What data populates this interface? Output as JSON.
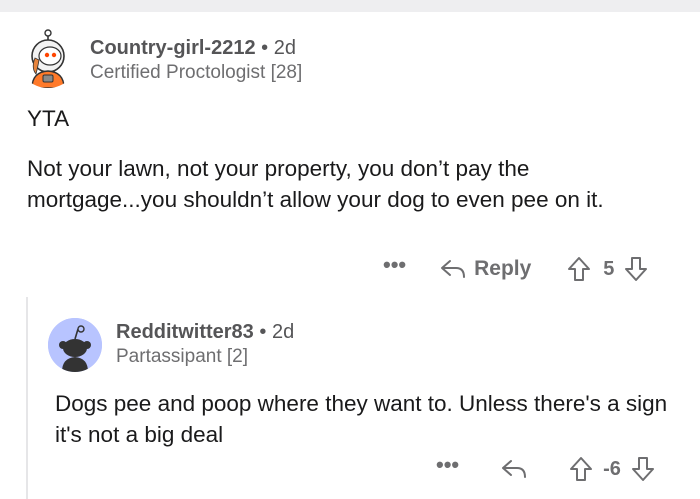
{
  "comments": [
    {
      "username": "Country-girl-2212",
      "separator": "•",
      "age": "2d",
      "flair": "Certified Proctologist [28]",
      "avatar_icon": "astronaut-snoo-avatar-icon",
      "body_line1": "YTA",
      "body_paragraph": "Not your lawn, not your property, you don’t pay the mortgage...you shouldn’t allow your dog to even pee on it.",
      "more_label": "•••",
      "reply_label": "Reply",
      "vote_count": "5"
    },
    {
      "username": "Redditwitter83",
      "separator": "•",
      "age": "2d",
      "flair": "Partassipant [2]",
      "avatar_icon": "default-snoo-avatar-icon",
      "body_paragraph": "Dogs pee and poop where they want to. Unless there's a sign it's not a big deal",
      "more_label": "•••",
      "vote_count": "-6"
    }
  ],
  "colors": {
    "meta_text": "#6e6e70",
    "body_text": "#1a1a1b",
    "thread_line": "#e6e6e8",
    "avatar2_bg": "#b8c4ff"
  }
}
